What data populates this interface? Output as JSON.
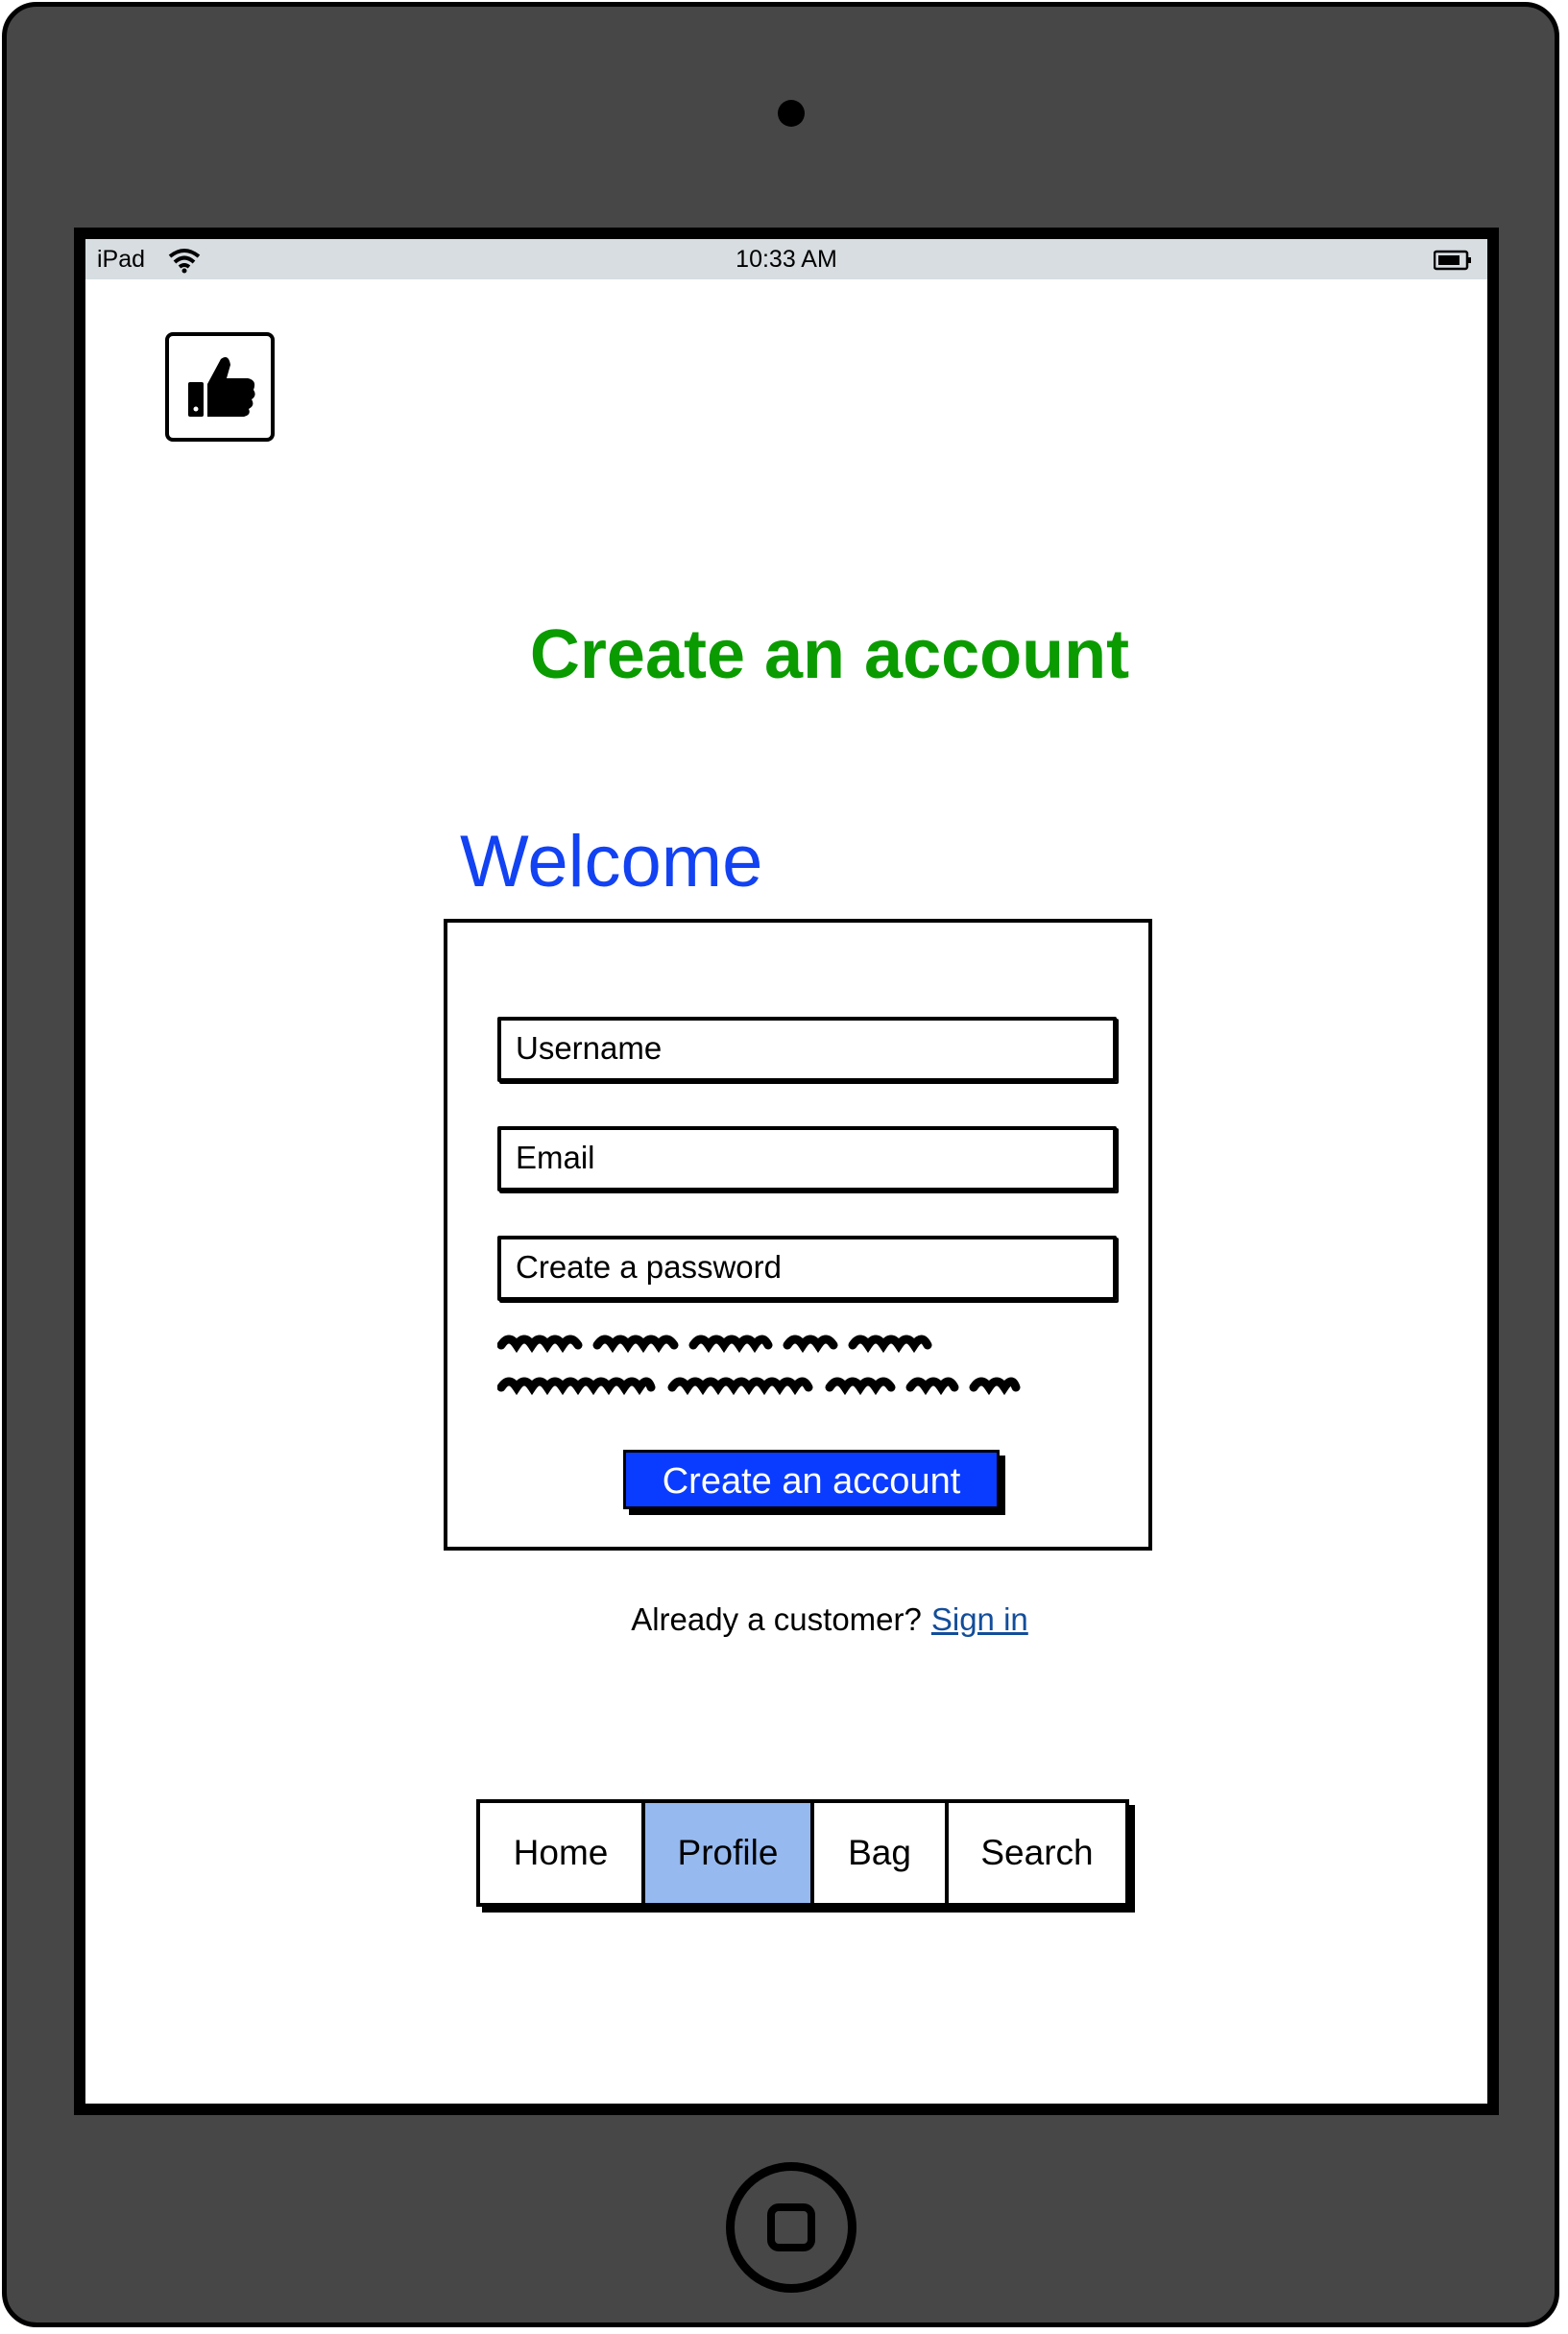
{
  "statusbar": {
    "device": "iPad",
    "time": "10:33 AM"
  },
  "page": {
    "title": "Create an account",
    "welcome": "Welcome",
    "title_color": "#0a9b00",
    "welcome_color": "#1242f2"
  },
  "form": {
    "username_placeholder": "Username",
    "email_placeholder": "Email",
    "password_placeholder": "Create a password",
    "submit_label": "Create an account",
    "submit_color": "#0a3cff"
  },
  "signin": {
    "prompt": "Already a customer?",
    "link": "Sign in"
  },
  "tabs": [
    {
      "label": "Home"
    },
    {
      "label": "Profile",
      "active": true
    },
    {
      "label": "Bag"
    },
    {
      "label": "Search"
    }
  ],
  "icons": {
    "logo": "thumbs-up-icon",
    "wifi": "wifi-icon",
    "battery": "battery-icon"
  }
}
